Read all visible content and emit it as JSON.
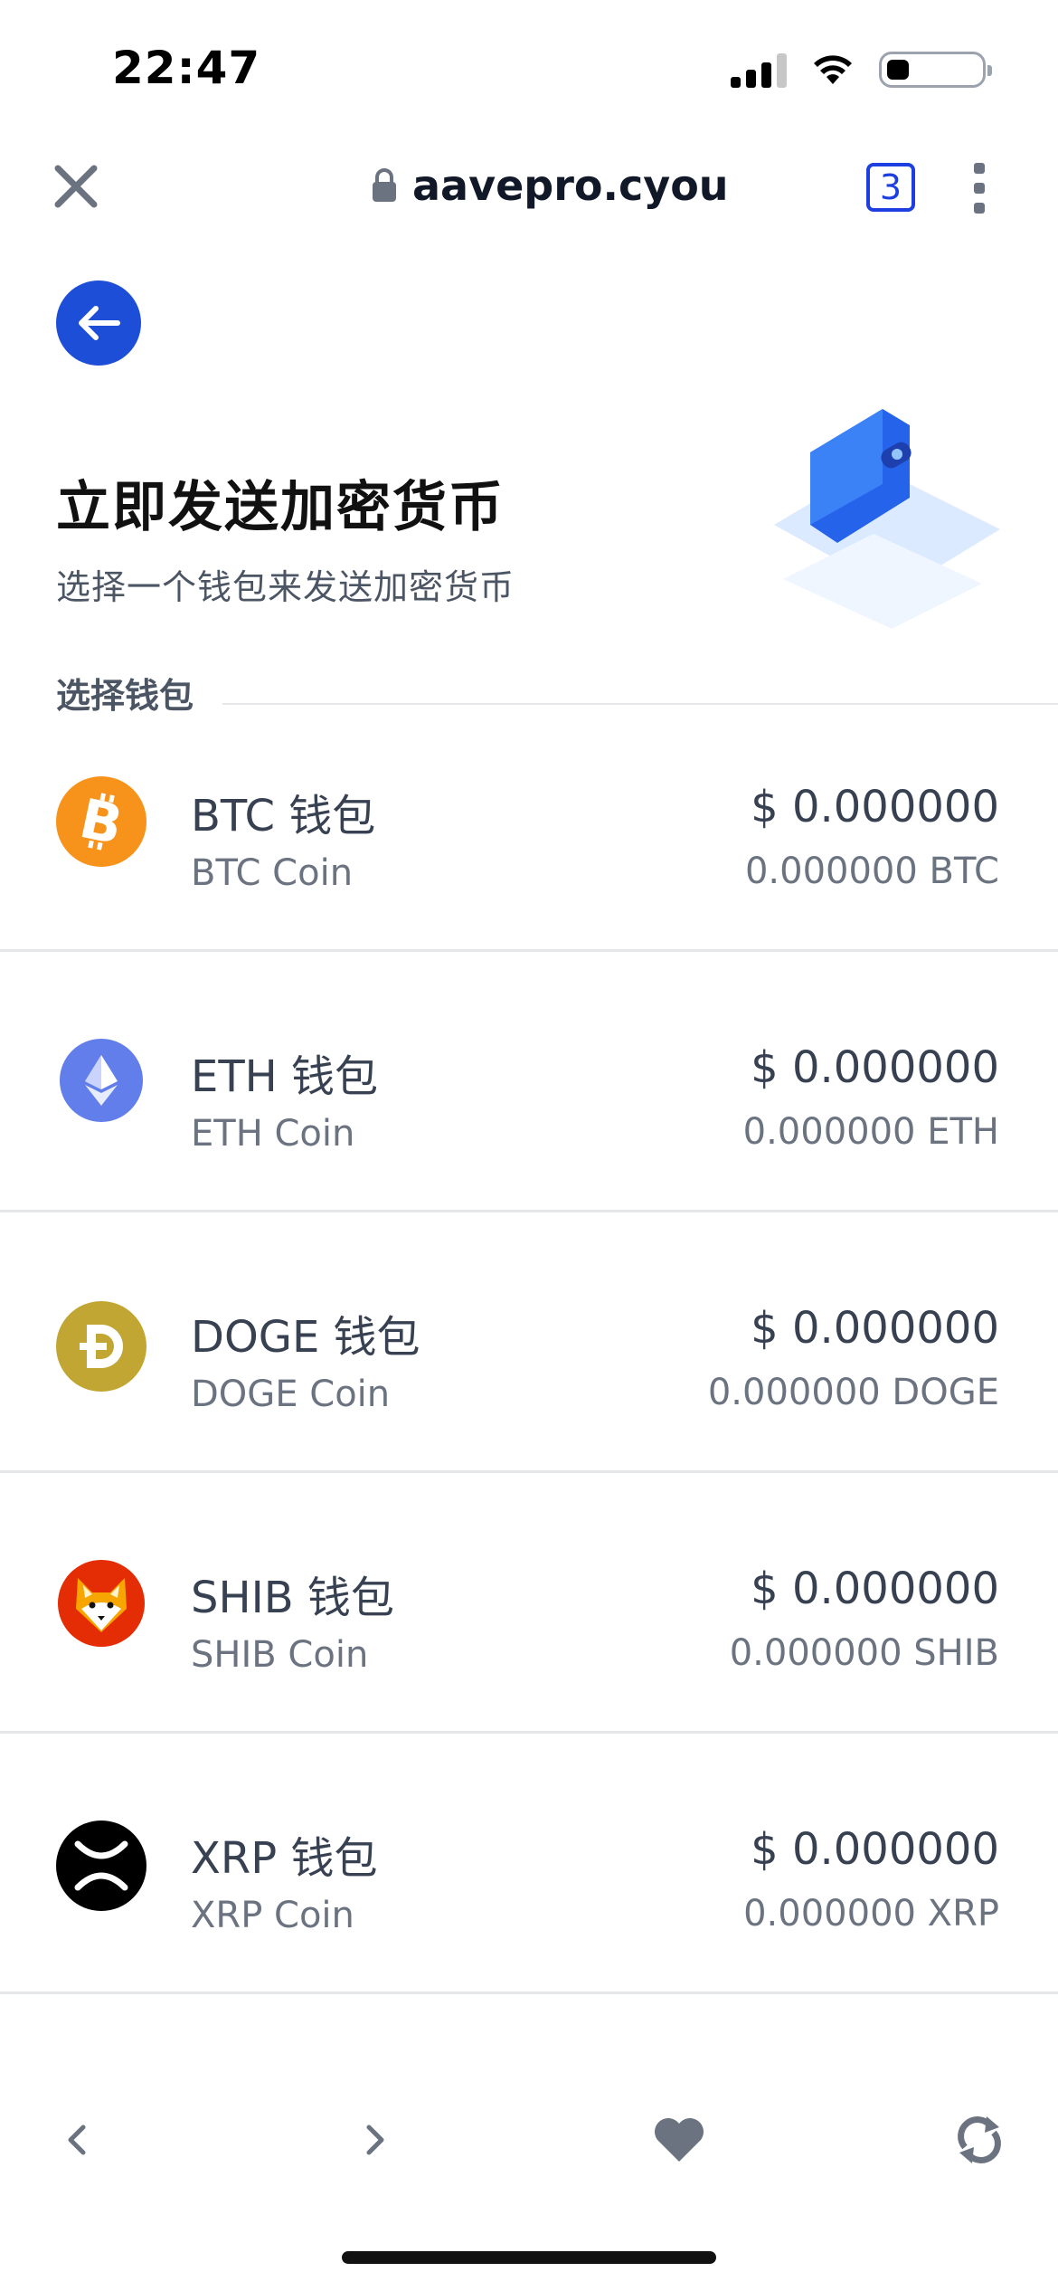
{
  "status_bar": {
    "time": "22:47"
  },
  "browser": {
    "url": "aavepro.cyou",
    "tab_count": "3"
  },
  "page": {
    "title": "立即发送加密货币",
    "subtitle": "选择一个钱包来发送加密货币",
    "section_label": "选择钱包"
  },
  "wallets": [
    {
      "name": "BTC 钱包",
      "sub": "BTC Coin",
      "usd": "$ 0.000000",
      "amount": "0.000000 BTC",
      "icon": "btc-icon",
      "color": "#f7931a"
    },
    {
      "name": "ETH 钱包",
      "sub": "ETH Coin",
      "usd": "$ 0.000000",
      "amount": "0.000000 ETH",
      "icon": "eth-icon",
      "color": "#627eea"
    },
    {
      "name": "DOGE 钱包",
      "sub": "DOGE Coin",
      "usd": "$ 0.000000",
      "amount": "0.000000 DOGE",
      "icon": "doge-icon",
      "color": "#c2a633"
    },
    {
      "name": "SHIB 钱包",
      "sub": "SHIB Coin",
      "usd": "$ 0.000000",
      "amount": "0.000000 SHIB",
      "icon": "shib-icon",
      "color": "#e42d04"
    },
    {
      "name": "XRP 钱包",
      "sub": "XRP Coin",
      "usd": "$ 0.000000",
      "amount": "0.000000 XRP",
      "icon": "xrp-icon",
      "color": "#000000"
    }
  ],
  "colors": {
    "accent": "#1d4ed8",
    "tab_badge": "#1d3ee0"
  }
}
